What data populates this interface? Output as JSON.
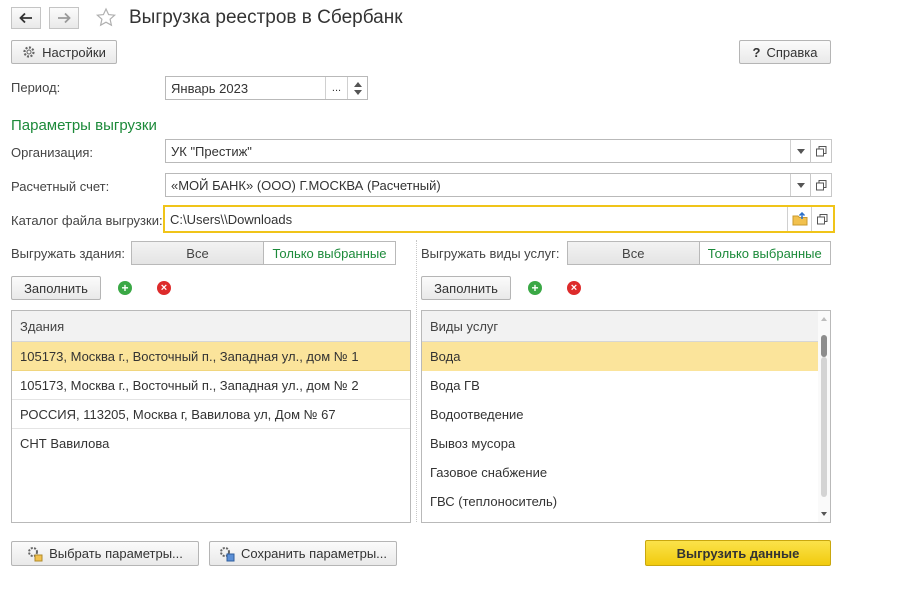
{
  "window": {
    "title": "Выгрузка реестров в Сбербанк"
  },
  "toolbar": {
    "settings_label": "Настройки",
    "help_label": "Справка"
  },
  "period": {
    "label": "Период:",
    "value": "Январь 2023",
    "choose": "..."
  },
  "params": {
    "heading": "Параметры выгрузки",
    "org_label": "Организация:",
    "org_value": "УК \"Престиж\"",
    "account_label": "Расчетный счет:",
    "account_value": "«МОЙ БАНК» (ООО) Г.МОСКВА (Расчетный)",
    "catalog_label": "Каталог файла выгрузки:",
    "catalog_value": "C:\\Users\\\\Downloads"
  },
  "buildings": {
    "label": "Выгружать здания:",
    "opt_all": "Все",
    "opt_selected": "Только выбранные",
    "fill_label": "Заполнить",
    "header": "Здания",
    "rows": [
      "105173, Москва г., Восточный п., Западная ул., дом № 1",
      "105173, Москва г., Восточный п., Западная ул., дом № 2",
      "РОССИЯ, 113205, Москва г, Вавилова ул, Дом № 67",
      "СНТ Вавилова"
    ]
  },
  "services": {
    "label": "Выгружать виды услуг:",
    "opt_all": "Все",
    "opt_selected": "Только выбранные",
    "fill_label": "Заполнить",
    "header": "Виды услуг",
    "rows": [
      "Вода",
      "Вода ГВ",
      "Водоотведение",
      "Вывоз мусора",
      "Газовое снабжение",
      "ГВС (теплоноситель)"
    ]
  },
  "footer": {
    "choose_params": "Выбрать параметры...",
    "save_params": "Сохранить параметры...",
    "export": "Выгрузить данные"
  },
  "colors": {
    "accent_green": "#1c8a3a",
    "selection": "#fbe49b",
    "export_button": "#f5d21a",
    "focus_border": "#f0c419"
  }
}
